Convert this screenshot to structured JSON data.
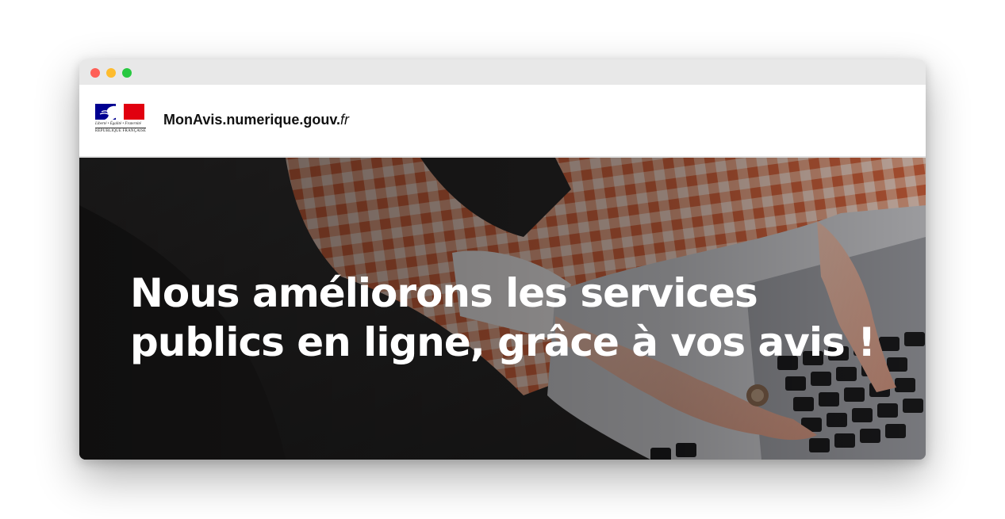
{
  "window": {
    "controls": [
      "close-dot",
      "minimize-dot",
      "maximize-dot"
    ],
    "control_colors": {
      "close": "#fe5f57",
      "minimize": "#febc2e",
      "maximize": "#28c840"
    }
  },
  "header": {
    "logo": {
      "icon": "marianne-logo",
      "motto": "Liberté • Égalité • Fraternité",
      "name": "RÉPUBLIQUE FRANÇAISE",
      "colors": {
        "blue": "#000091",
        "red": "#e1000f"
      }
    },
    "site_name_main": "MonAvis.numerique.gouv.",
    "site_name_tld": "fr"
  },
  "hero": {
    "background": "photo-woman-typing-on-laptop",
    "title_line_1": "Nous améliorons les services",
    "title_line_2": "publics en ligne, grâce à vos avis !"
  }
}
